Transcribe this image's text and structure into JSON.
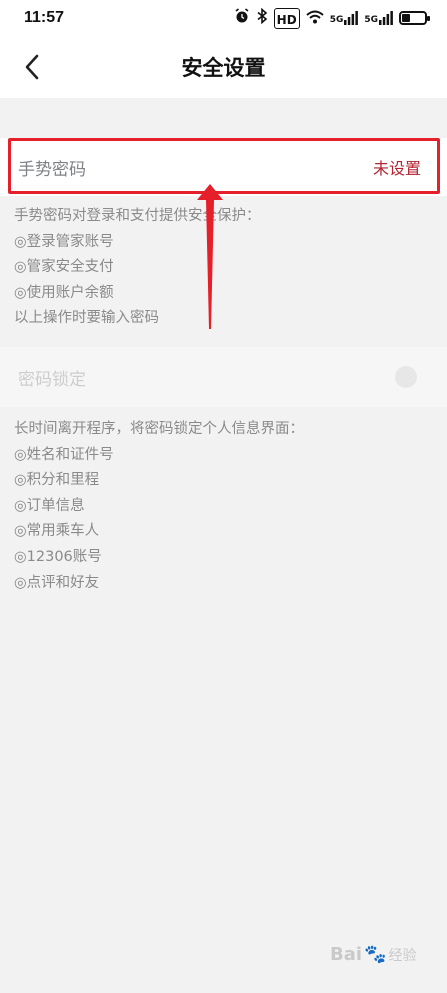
{
  "status_bar": {
    "time": "11:57",
    "icons": [
      "alarm-icon",
      "bluetooth-icon",
      "hd-icon",
      "wifi-icon",
      "5g-signal-icon",
      "5g-signal-icon",
      "battery-icon"
    ],
    "hd_label": "HD",
    "sig1_label": "5G",
    "sig2_label": "5G",
    "battery_level": 0.35
  },
  "nav": {
    "title": "安全设置",
    "back_icon": "chevron-left-icon"
  },
  "gesture": {
    "label": "手势密码",
    "status": "未设置",
    "description": [
      "手势密码对登录和支付提供安全保护：",
      "◎登录管家账号",
      "◎管家安全支付",
      "◎使用账户余额",
      "以上操作时要输入密码"
    ]
  },
  "lock": {
    "label": "密码锁定",
    "enabled": false,
    "description": [
      "长时间离开程序，将密码锁定个人信息界面：",
      "◎姓名和证件号",
      "◎积分和里程",
      "◎订单信息",
      "◎常用乘车人",
      "◎12306账号",
      "◎点评和好友"
    ]
  },
  "watermark": {
    "text_left": "Bai",
    "text_right": "经验"
  },
  "colors": {
    "accent_red": "#b2232f",
    "highlight_red": "#e5202a",
    "background": "#f2f2f2"
  }
}
